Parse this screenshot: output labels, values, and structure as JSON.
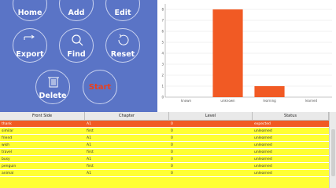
{
  "buttons": {
    "home": "Home",
    "add": "Add",
    "edit": "Edit",
    "export": "Export",
    "find": "Find",
    "reset": "Reset",
    "delete": "Delete",
    "start": "Start"
  },
  "colors": {
    "panel": "#5a74c6",
    "accent": "#e8401f",
    "bar": "#f15a24",
    "table": "#ffff33"
  },
  "chart_data": {
    "type": "bar",
    "categories": [
      "known",
      "unknown",
      "learning",
      "learned"
    ],
    "values": [
      0,
      8,
      1,
      0
    ],
    "ylim": [
      0,
      8.5
    ],
    "yticks": [
      "0",
      "1",
      "2",
      "3",
      "4",
      "5",
      "6",
      "7",
      "8"
    ],
    "grid": true
  },
  "table": {
    "headers": [
      "Front Side",
      "Chapter",
      "Level",
      "Status"
    ],
    "rows": [
      [
        "thank",
        "A1",
        "0",
        "expected"
      ],
      [
        "similar",
        "first",
        "0",
        "unlearned"
      ],
      [
        "friend",
        "A1",
        "0",
        "unlearned"
      ],
      [
        "wish",
        "A1",
        "0",
        "unlearned"
      ],
      [
        "travel",
        "first",
        "0",
        "unlearned"
      ],
      [
        "busy",
        "A1",
        "0",
        "unlearned"
      ],
      [
        "penguin",
        "first",
        "0",
        "unlearned"
      ],
      [
        "animal",
        "A1",
        "0",
        "unlearned"
      ]
    ],
    "selected_row": 0
  }
}
